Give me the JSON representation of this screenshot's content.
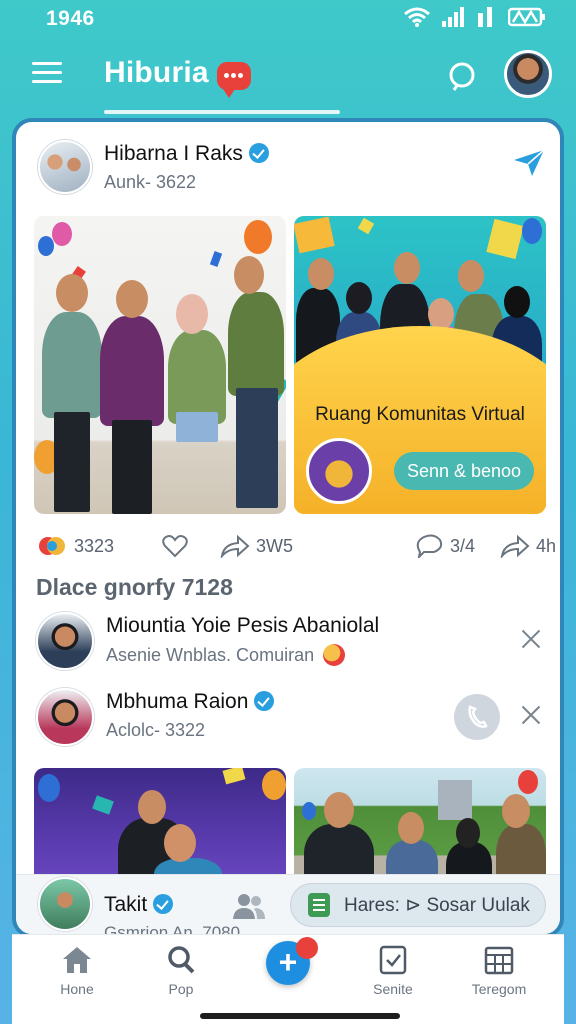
{
  "status_bar": {
    "time": "1946"
  },
  "header": {
    "title": "Hiburia"
  },
  "post": {
    "author": "Hibarna I Raks",
    "sub": "Aunk- 3622",
    "image_right": {
      "caption": "Ruang Komunitas Virtual",
      "button": "Senn & benoo"
    },
    "actions": {
      "reactions": "3323",
      "shares": "3W5",
      "comments": "3/4",
      "time": "4h"
    }
  },
  "section": {
    "title": "Dlace gnorfy 7128"
  },
  "suggestions": [
    {
      "name": "Miountia Yoie Pesis Abaniolal",
      "sub": "Asenie Wnblas. Comuiran"
    },
    {
      "name": "Mbhuma Raion",
      "sub": "Aclolc- 3322"
    }
  ],
  "bottom_strip": {
    "name": "Takit",
    "sub": "Gsmrion An. 7080",
    "pill_text": "Hares: ⊳ Sosar Uulak"
  },
  "nav": {
    "items": [
      "Hone",
      "Pop",
      "Senite",
      "Teregom"
    ]
  }
}
